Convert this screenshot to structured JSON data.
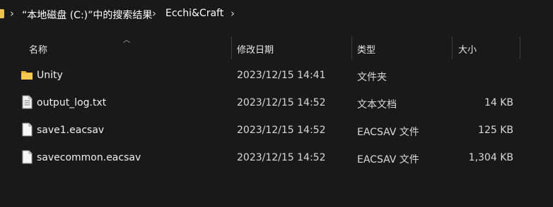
{
  "breadcrumb": {
    "items": [
      "“本地磁盘 (C:)”中的搜索结果",
      "Ecchi&Craft"
    ],
    "separator": "›"
  },
  "columns": {
    "name": "名称",
    "modified": "修改日期",
    "type": "类型",
    "size": "大小"
  },
  "files": [
    {
      "icon": "folder-icon",
      "name": "Unity",
      "modified": "2023/12/15 14:41",
      "type": "文件夹",
      "size": ""
    },
    {
      "icon": "text-file-icon",
      "name": "output_log.txt",
      "modified": "2023/12/15 14:52",
      "type": "文本文档",
      "size": "14 KB"
    },
    {
      "icon": "file-icon",
      "name": "save1.eacsav",
      "modified": "2023/12/15 14:52",
      "type": "EACSAV 文件",
      "size": "125 KB"
    },
    {
      "icon": "file-icon",
      "name": "savecommon.eacsav",
      "modified": "2023/12/15 14:52",
      "type": "EACSAV 文件",
      "size": "1,304 KB"
    }
  ],
  "colors": {
    "background": "#191919",
    "folder": "#f0c24a",
    "text": "#ffffff"
  }
}
